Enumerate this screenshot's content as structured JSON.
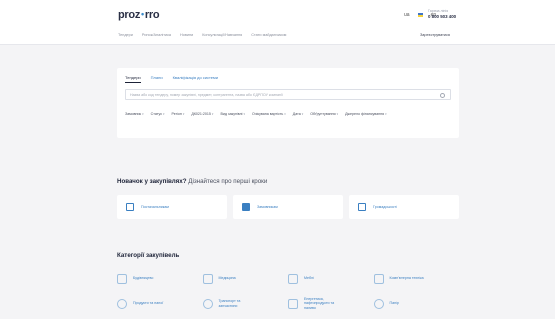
{
  "header": {
    "logo_left": "proz",
    "logo_dot": "•",
    "logo_right": "rro",
    "lang_ua": "ua",
    "lang_en": "en",
    "phone_label": "Гаряча лінія",
    "phone_number": "0 800 503 400",
    "nav": [
      "Тендери",
      "Ринок/Аналітика",
      "Новини",
      "Консультації/Навчання",
      "Стати майданчиком"
    ],
    "login": "Зареєструватися"
  },
  "search": {
    "tabs": [
      "Тендери",
      "Плани",
      "Кваліфікація до системи"
    ],
    "active_tab": 0,
    "placeholder": "Назва або код тендеру, номер закупівлі, предмет, контрагента, назва або ЄДРПОУ компанії",
    "filters": [
      "Замовник",
      "Статус",
      "Регіон",
      "ДК021:2015",
      "Вид закупівлі",
      "Очікувана вартість",
      "Дата",
      "Обґрунтування",
      "Джерело фінансування"
    ]
  },
  "first_steps": {
    "title_bold": "Новачок у закупівлях?",
    "title_rest": " Дізнайтеся про перші кроки",
    "items": [
      "Постачальникам",
      "Замовникам",
      "Громадськості"
    ]
  },
  "categories": {
    "title": "Категорії закупівель",
    "items": [
      "Будівництво",
      "Медицина",
      "Меблі",
      "Комп'ютерна техніка",
      "Продукти та напої",
      "Транспорт та запчастини",
      "Енергетика, нафтопродукти та паливо",
      "Папір"
    ]
  },
  "colors": {
    "accent": "#3a7fc1",
    "background": "#f4f4f6",
    "card": "#ffffff",
    "text": "#1d2338"
  }
}
